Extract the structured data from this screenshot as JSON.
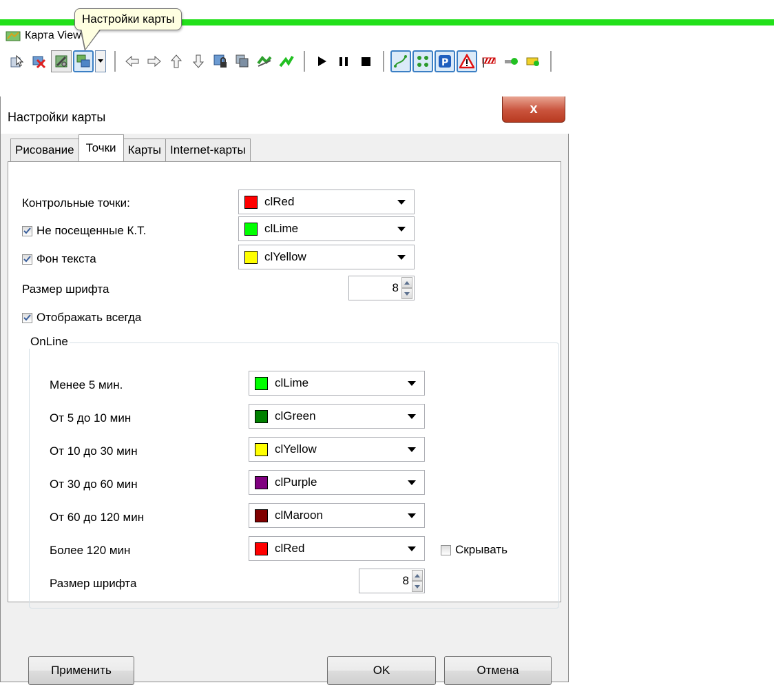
{
  "app": {
    "title": "Карта Viewer"
  },
  "tooltip": {
    "text": "Настройки карты"
  },
  "toolbar": {
    "icons": [
      "select-tool-icon",
      "delete-tool-icon",
      "map-settings-icon",
      "layer-switch-icon",
      "arrow-left-icon",
      "arrow-right-icon",
      "arrow-up-icon",
      "arrow-down-icon",
      "lock-map-icon",
      "copy-map-icon",
      "route-icon",
      "route-green-icon",
      "play-icon",
      "pause-icon",
      "stop-icon",
      "track-line-icon",
      "points-icon",
      "parking-icon",
      "warning-icon",
      "barrier-icon",
      "car-green-icon",
      "car-yellow-icon"
    ]
  },
  "dialog": {
    "title": "Настройки карты",
    "close_label": "x",
    "tabs": [
      "Рисование",
      "Точки",
      "Карты",
      "Internet-карты"
    ],
    "active_tab": "Точки",
    "control_points_label": "Контрольные точки:",
    "control_points_color": {
      "name": "clRed",
      "hex": "#ff0000"
    },
    "unvisited": {
      "label": "Не посещенные К.Т.",
      "checked": true,
      "color": {
        "name": "clLime",
        "hex": "#00ff00"
      }
    },
    "text_bg": {
      "label": "Фон текста",
      "checked": true,
      "color": {
        "name": "clYellow",
        "hex": "#ffff00"
      }
    },
    "font_size_label": "Размер шрифта",
    "font_size_value": "8",
    "show_always": {
      "label": "Отображать всегда",
      "checked": true
    },
    "online": {
      "title": "OnLine",
      "rows": [
        {
          "label": "Менее 5 мин.",
          "color": "clLime",
          "hex": "#00ff00"
        },
        {
          "label": "От 5 до 10 мин",
          "color": "clGreen",
          "hex": "#008000"
        },
        {
          "label": "От 10 до 30 мин",
          "color": "clYellow",
          "hex": "#ffff00"
        },
        {
          "label": "От 30 до 60 мин",
          "color": "clPurple",
          "hex": "#800080"
        },
        {
          "label": "От 60 до 120 мин",
          "color": "clMaroon",
          "hex": "#800000"
        },
        {
          "label": "Более 120 мин",
          "color": "clRed",
          "hex": "#ff0000"
        }
      ],
      "hide_label": "Скрывать",
      "hide_checked": false,
      "font_size_label": "Размер шрифта",
      "font_size_value": "8"
    },
    "buttons": {
      "apply": "Применить",
      "ok": "OK",
      "cancel": "Отмена"
    }
  }
}
